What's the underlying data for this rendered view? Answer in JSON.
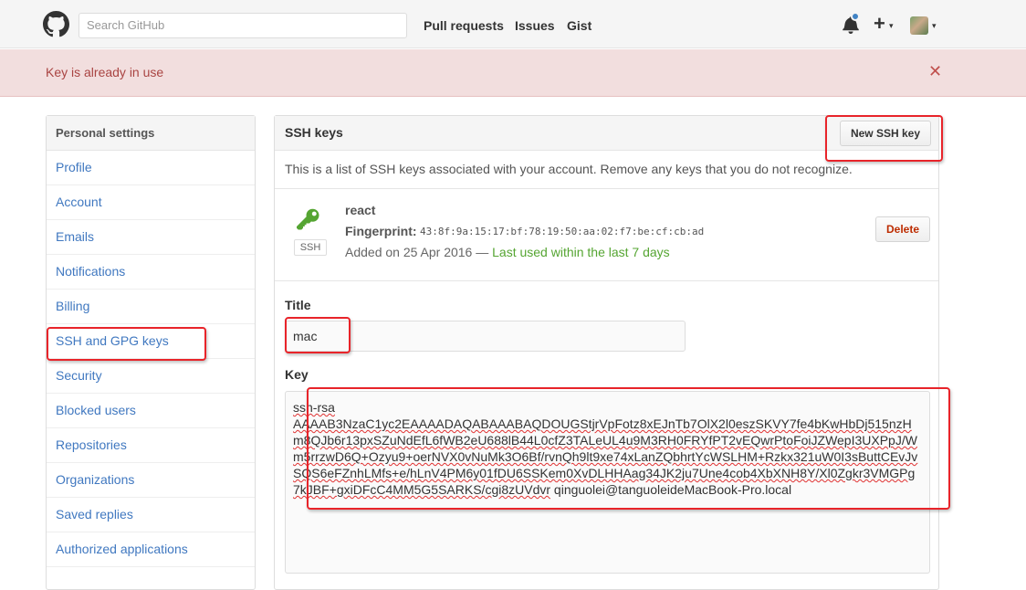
{
  "header": {
    "search_placeholder": "Search GitHub",
    "nav": [
      "Pull requests",
      "Issues",
      "Gist"
    ],
    "plus": "+",
    "caret": "▾"
  },
  "flash": {
    "message": "Key is already in use",
    "close": "✕"
  },
  "sidebar": {
    "title": "Personal settings",
    "items": [
      {
        "label": "Profile"
      },
      {
        "label": "Account"
      },
      {
        "label": "Emails"
      },
      {
        "label": "Notifications"
      },
      {
        "label": "Billing"
      },
      {
        "label": "SSH and GPG keys"
      },
      {
        "label": "Security"
      },
      {
        "label": "Blocked users"
      },
      {
        "label": "Repositories"
      },
      {
        "label": "Organizations"
      },
      {
        "label": "Saved replies"
      },
      {
        "label": "Authorized applications"
      }
    ]
  },
  "main": {
    "title": "SSH keys",
    "new_key_button": "New SSH key",
    "intro": "This is a list of SSH keys associated with your account. Remove any keys that you do not recognize.",
    "key": {
      "badge": "SSH",
      "title": "react",
      "fingerprint_label": "Fingerprint:",
      "fingerprint": "43:8f:9a:15:17:bf:78:19:50:aa:02:f7:be:cf:cb:ad",
      "added": "Added on 25 Apr 2016 —",
      "last_used": "Last used within the last 7 days",
      "delete_button": "Delete"
    },
    "form": {
      "title_label": "Title",
      "title_value": "mac",
      "key_label": "Key",
      "key_type": "ssh-rsa",
      "key_body": "AAAAB3NzaC1yc2EAAAADAQABAAABAQDOUGStjrVpFotz8xEJnTb7OlX2l0eszSKVY7fe4bKwHbDj515nzHm8QJb6r13pxSZuNdEfL6fWB2eU688lB44L0cfZ3TALeUL4u9M3RH0FRYfPT2vEQwrPtoFoiJZWepI3UXPpJ/Wm5rrzwD6Q+Ozyu9+oerNVX0vNuMk3O6Bf/rvnQh9lt9xe74xLanZQbhrtYcWSLHM+Rzkx321uW0I3sButtCEvJvSQS6eFZnhLMfs+e/hLnV4PM6y01fDU6SSKem0XvDLHHAag34JK2ju7Une4cob4XbXNH8Y/Xl0Zgkr3VMGPg7kJBF+gxiDFcC4MM5G5SARKS/cgi8zUVdvr",
      "key_comment": "qinguolei@tanguoleideMacBook-Pro.local"
    }
  },
  "colors": {
    "link": "#4078c0",
    "flash_bg": "#f2dede",
    "flash_text": "#a94442",
    "highlight": "#e8242a",
    "success": "#55a532",
    "danger": "#bd2c00"
  }
}
